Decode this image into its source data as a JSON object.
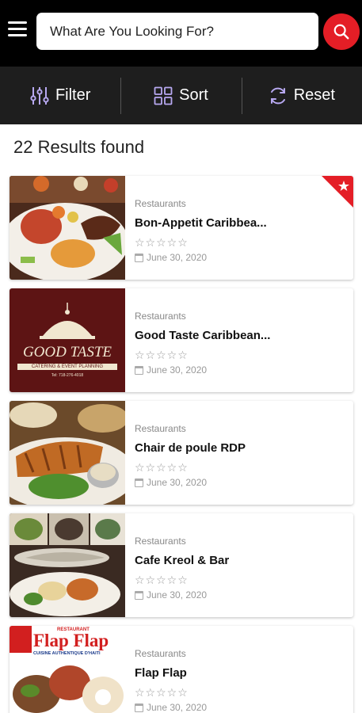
{
  "search": {
    "placeholder": "What Are You Looking For?"
  },
  "toolbar": {
    "filter_label": "Filter",
    "sort_label": "Sort",
    "reset_label": "Reset"
  },
  "results": {
    "count_text": "22 Results found"
  },
  "listings": [
    {
      "category": "Restaurants",
      "title": "Bon-Appetit Caribbea...",
      "stars": "☆☆☆☆☆",
      "date": "June 30, 2020",
      "featured": true
    },
    {
      "category": "Restaurants",
      "title": "Good Taste Caribbean...",
      "stars": "☆☆☆☆☆",
      "date": "June 30, 2020",
      "featured": false
    },
    {
      "category": "Restaurants",
      "title": "Chair de poule RDP",
      "stars": "☆☆☆☆☆",
      "date": "June 30, 2020",
      "featured": false
    },
    {
      "category": "Restaurants",
      "title": "Cafe Kreol & Bar",
      "stars": "☆☆☆☆☆",
      "date": "June 30, 2020",
      "featured": false
    },
    {
      "category": "Restaurants",
      "title": "Flap Flap",
      "stars": "☆☆☆☆☆",
      "date": "June 30, 2020",
      "featured": false
    }
  ],
  "logos": {
    "good_taste": {
      "name": "GOOD TASTE",
      "tagline": "CATERING & EVENT PLANNING",
      "phone": "Tel: 718-276-4018"
    },
    "flap_flap": {
      "small": "RESTAURANT",
      "name": "Flap Flap",
      "tagline": "CUISINE AUTHENTIQUE D'HAITI"
    }
  },
  "colors": {
    "accent": "#e41e26",
    "topbar": "#000000",
    "toolbar": "#1e1e1e"
  }
}
